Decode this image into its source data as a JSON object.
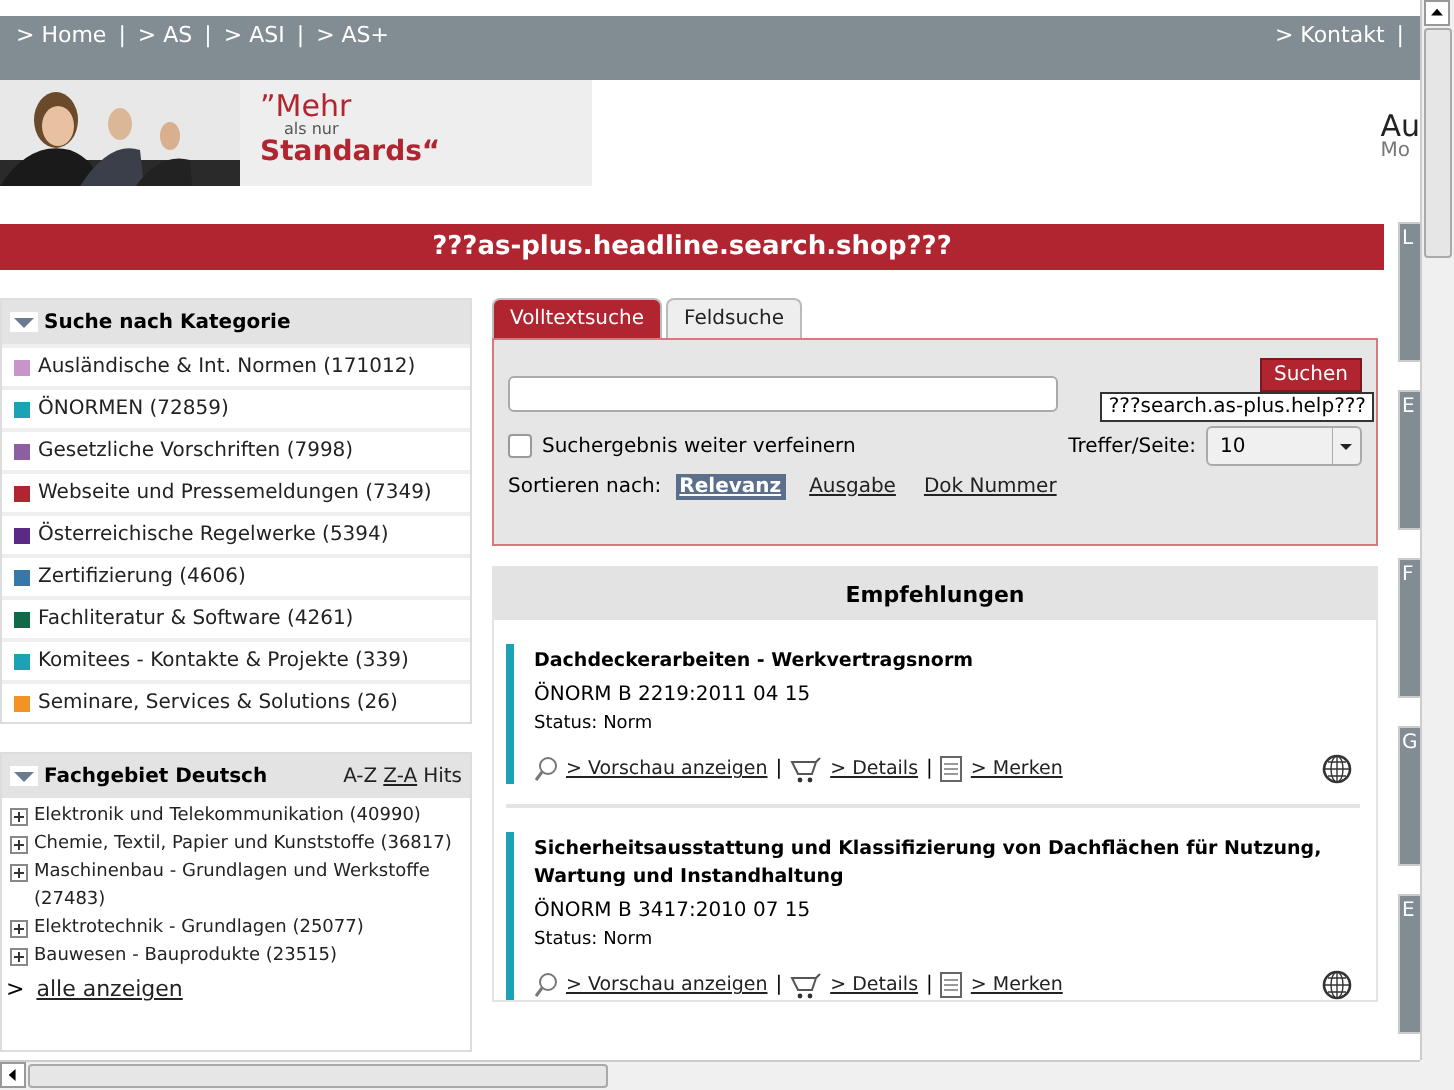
{
  "nav": {
    "left": [
      "> Home",
      "> AS",
      "> ASI",
      "> AS+"
    ],
    "right": [
      "> Kontakt"
    ],
    "separator": "|"
  },
  "banner": {
    "quote_open": "”",
    "line1": "Mehr",
    "line2": "als nur",
    "line3": "Standards",
    "quote_close": "“",
    "side_title": "Au",
    "side_sub": "Mo"
  },
  "headline": "???as-plus.headline.search.shop???",
  "categories": {
    "title": "Suche nach Kategorie",
    "items": [
      {
        "label": "Ausländische & Int. Normen (171012)",
        "color": "#c994c7"
      },
      {
        "label": "ÖNORMEN (72859)",
        "color": "#1aa3b5"
      },
      {
        "label": "Gesetzliche Vorschriften (7998)",
        "color": "#8c5fa0"
      },
      {
        "label": "Webseite und Pressemeldungen (7349)",
        "color": "#b0252f"
      },
      {
        "label": "Österreichische Regelwerke (5394)",
        "color": "#5b2a82"
      },
      {
        "label": "Zertifizierung (4606)",
        "color": "#3579a8"
      },
      {
        "label": "Fachliteratur & Software (4261)",
        "color": "#0f6b47"
      },
      {
        "label": "Komitees - Kontakte & Projekte (339)",
        "color": "#1aa3b5"
      },
      {
        "label": "Seminare, Services & Solutions (26)",
        "color": "#f39323"
      }
    ]
  },
  "fachgebiet": {
    "title": "Fachgebiet Deutsch",
    "sorts": [
      {
        "label": "A-Z",
        "selected": false
      },
      {
        "label": "Z-A",
        "selected": true
      },
      {
        "label": "Hits",
        "selected": false
      }
    ],
    "items": [
      {
        "label": "Elektronik und Telekommunikation (40990)",
        "expanded": false
      },
      {
        "label": "Chemie, Textil, Papier und Kunststoffe (36817)",
        "expanded": false
      },
      {
        "label": "Maschinenbau - Grundlagen und Werkstoffe (27483)",
        "expanded": false
      },
      {
        "label": "Elektrotechnik - Grundlagen (25077)",
        "expanded": false
      },
      {
        "label": "Bauwesen - Bauprodukte (23515)",
        "expanded": false
      }
    ],
    "more_prefix": ">",
    "more": "alle anzeigen"
  },
  "search": {
    "tabs": [
      {
        "label": "Volltextsuche",
        "selected": true
      },
      {
        "label": "Feldsuche",
        "selected": false
      }
    ],
    "button": "Suchen",
    "help": "???search.as-plus.help???",
    "refine": {
      "label": "Suchergebnis weiter verfeinern",
      "checked": false
    },
    "per_page_label": "Treffer/Seite:",
    "per_page": "10",
    "sort_label": "Sortieren nach:",
    "sorts": [
      {
        "label": "Relevanz",
        "selected": true
      },
      {
        "label": "Ausgabe",
        "selected": false
      },
      {
        "label": "Dok Nummer",
        "selected": false
      }
    ]
  },
  "recommendations": {
    "title": "Empfehlungen",
    "items": [
      {
        "title": "Dachdeckerarbeiten - Werkvertragsnorm",
        "norm": "ÖNORM B 2219:2011 04 15",
        "status": "Status: Norm",
        "actions": [
          {
            "kind": "preview",
            "label": "> Vorschau anzeigen"
          },
          {
            "kind": "cart",
            "label": "> Details"
          },
          {
            "kind": "note",
            "label": "> Merken"
          }
        ],
        "separator": "|"
      },
      {
        "title": "Sicherheitsausstattung und Klassifizierung von Dachflächen für Nutzung, Wartung und Instandhaltung",
        "norm": "ÖNORM B 3417:2010 07 15",
        "status": "Status: Norm",
        "actions": [
          {
            "kind": "preview",
            "label": "> Vorschau anzeigen"
          },
          {
            "kind": "cart",
            "label": "> Details"
          },
          {
            "kind": "note",
            "label": "> Merken"
          }
        ],
        "separator": "|"
      }
    ]
  },
  "right_column": [
    "L",
    "E",
    "F",
    "G",
    "E"
  ]
}
